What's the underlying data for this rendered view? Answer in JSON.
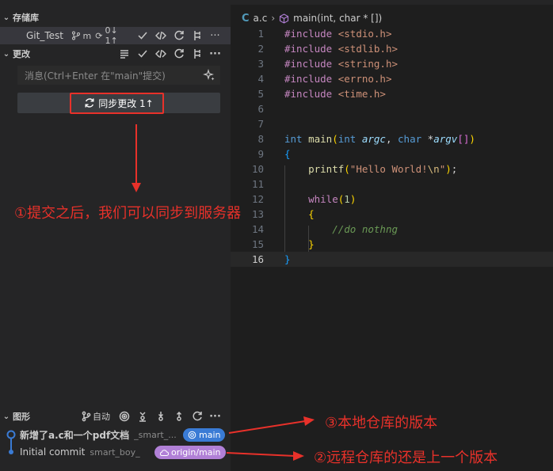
{
  "sidebar": {
    "repos_header": "存储库",
    "repo": {
      "name": "Git_Test",
      "branch": "m",
      "sync": "0↓ 1↑"
    },
    "changes_header": "更改",
    "commit_input": {
      "placeholder": "消息(Ctrl+Enter 在\"main\"提交)"
    },
    "sync_button": "同步更改 1↑",
    "graph_header": "图形",
    "graph_auto": "自动",
    "commits": [
      {
        "message": "新增了a.c和一个pdf文档",
        "author": "_smart_...",
        "badge": "main",
        "badge_color": "#3a7bd5"
      },
      {
        "message": "Initial commit",
        "author": "smart_boy_",
        "badge": "origin/main",
        "badge_color": "#b180d7"
      }
    ]
  },
  "editor": {
    "breadcrumb": {
      "file": "a.c",
      "symbol": "main(int, char * [])"
    },
    "active_line": 16,
    "lines": [
      {
        "n": "1"
      },
      {
        "n": "2"
      },
      {
        "n": "3"
      },
      {
        "n": "4"
      },
      {
        "n": "5"
      },
      {
        "n": "6"
      },
      {
        "n": "7"
      },
      {
        "n": "8"
      },
      {
        "n": "9"
      },
      {
        "n": "10"
      },
      {
        "n": "11"
      },
      {
        "n": "12"
      },
      {
        "n": "13"
      },
      {
        "n": "14"
      },
      {
        "n": "15"
      },
      {
        "n": "16"
      }
    ],
    "code": {
      "inc": "#include",
      "h1": "<stdio.h>",
      "h2": "<stdlib.h>",
      "h3": "<string.h>",
      "h4": "<errno.h>",
      "h5": "<time.h>",
      "int": "int",
      "main": "main",
      "argc": "argc",
      "char": "char",
      "argv": "argv",
      "printf": "printf",
      "hello": "\"Hello World!",
      "esc": "\\n",
      "quote": "\"",
      "while": "while",
      "one": "1",
      "comment": "//do nothng"
    }
  },
  "annotations": {
    "a1": "①提交之后，我们可以同步到服务器",
    "a2": "③本地仓库的版本",
    "a3": "②远程仓库的还是上一个版本",
    "color": "#e8312a"
  }
}
